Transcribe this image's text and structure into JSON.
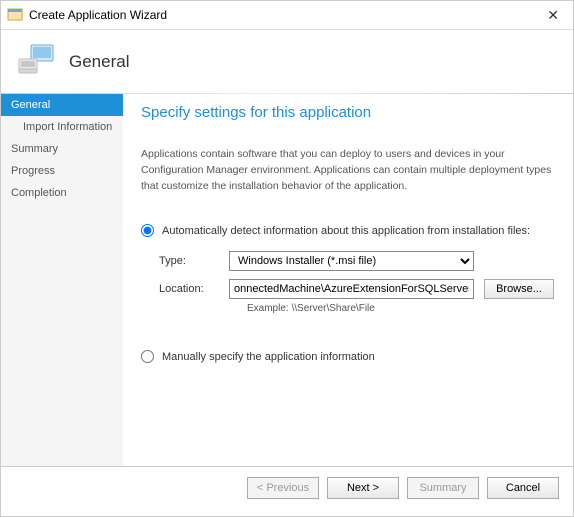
{
  "window": {
    "title": "Create Application Wizard"
  },
  "header": {
    "label": "General"
  },
  "sidebar": {
    "items": [
      {
        "label": "General"
      },
      {
        "label": "Import Information"
      },
      {
        "label": "Summary"
      },
      {
        "label": "Progress"
      },
      {
        "label": "Completion"
      }
    ]
  },
  "main": {
    "heading": "Specify settings for this application",
    "description": "Applications contain software that you can deploy to users and devices in your Configuration Manager environment. Applications can contain multiple deployment types that customize the installation behavior of the application.",
    "option_auto": "Automatically detect information about this application from installation files:",
    "option_manual": "Manually specify the application information",
    "type_label": "Type:",
    "type_value": "Windows Installer (*.msi file)",
    "location_label": "Location:",
    "location_value": "onnectedMachine\\AzureExtensionForSQLServer.msi",
    "browse_label": "Browse...",
    "example_label": "Example: \\\\Server\\Share\\File"
  },
  "footer": {
    "previous": "< Previous",
    "next": "Next >",
    "summary": "Summary",
    "cancel": "Cancel"
  }
}
